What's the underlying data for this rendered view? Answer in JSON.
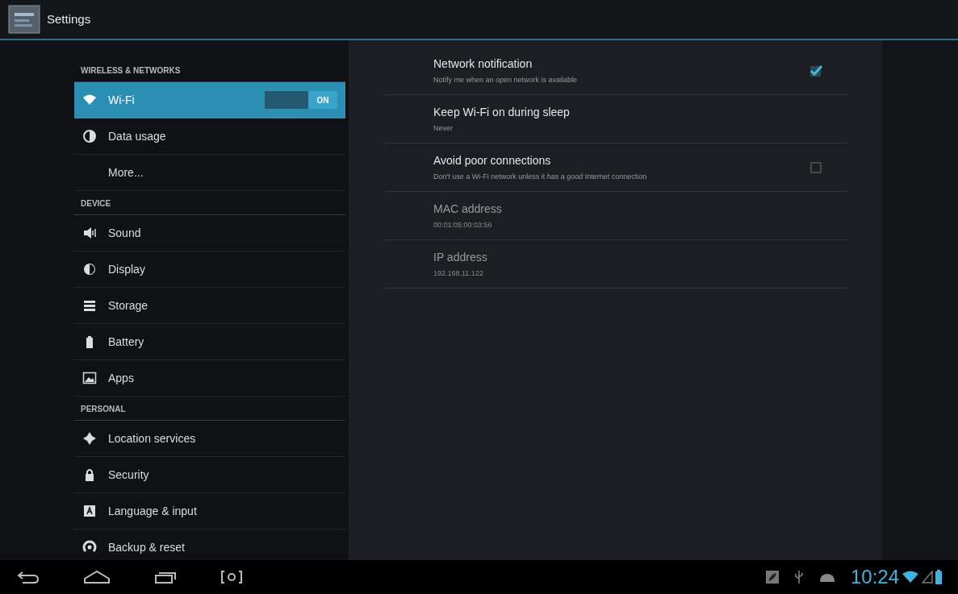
{
  "action_bar": {
    "title": "Settings"
  },
  "sidebar": {
    "sections": [
      {
        "header": "WIRELESS & NETWORKS",
        "items": [
          {
            "label": "Wi-Fi",
            "kind": "wifi",
            "selected": true,
            "toggle": {
              "label": "ON",
              "on": true
            }
          },
          {
            "label": "Data usage",
            "kind": "data",
            "selected": false
          },
          {
            "label": "More...",
            "kind": "plain",
            "selected": false
          }
        ]
      },
      {
        "header": "DEVICE",
        "items": [
          {
            "label": "Sound",
            "kind": "sound",
            "selected": false
          },
          {
            "label": "Display",
            "kind": "display",
            "selected": false
          },
          {
            "label": "Storage",
            "kind": "storage",
            "selected": false
          },
          {
            "label": "Battery",
            "kind": "battery",
            "selected": false
          },
          {
            "label": "Apps",
            "kind": "apps",
            "selected": false
          }
        ]
      },
      {
        "header": "PERSONAL",
        "items": [
          {
            "label": "Location services",
            "kind": "location",
            "selected": false
          },
          {
            "label": "Security",
            "kind": "lock",
            "selected": false
          },
          {
            "label": "Language & input",
            "kind": "language",
            "selected": false
          },
          {
            "label": "Backup & reset",
            "kind": "backup",
            "selected": false
          }
        ]
      }
    ]
  },
  "preferences": [
    {
      "kind": "checkbox",
      "title": "Network notification",
      "summary": "Notify me when an open network is available",
      "checked": true
    },
    {
      "kind": "list",
      "title": "Keep Wi-Fi on during sleep",
      "summary": "Never"
    },
    {
      "kind": "checkbox",
      "title": "Avoid poor connections",
      "summary": "Don't use a Wi-Fi network unless it has a good Internet connection",
      "checked": false
    },
    {
      "kind": "info",
      "title": "MAC address",
      "summary": "00:01:05:00:03:56"
    },
    {
      "kind": "info",
      "title": "IP address",
      "summary": "192.168.11.122"
    }
  ],
  "system_bar": {
    "time": "10:24"
  }
}
